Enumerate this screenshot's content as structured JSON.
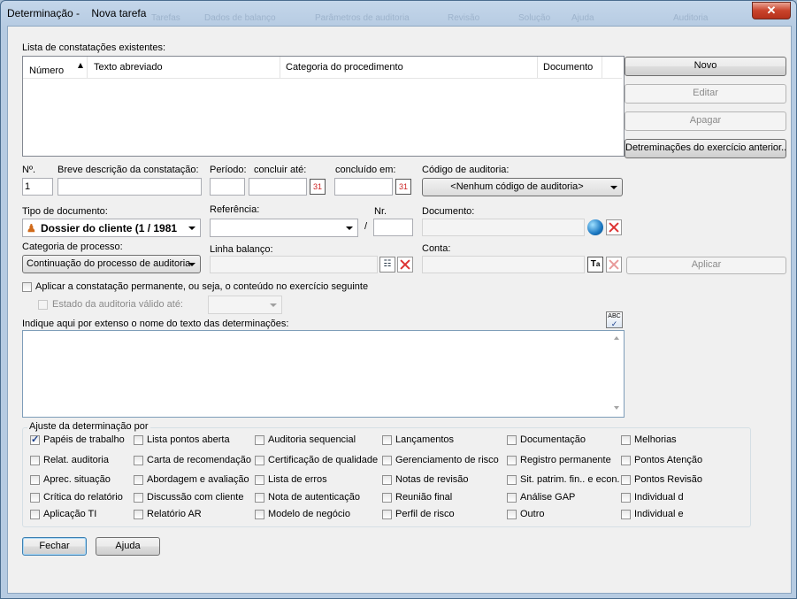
{
  "window": {
    "title": "Determinação -    Nova tarefa",
    "close_label": "✕",
    "background_menu": [
      "Tarefas",
      "Dados de balanço",
      "Parâmetros de auditoria",
      "Revisão",
      "Solução",
      "Ajuda",
      "Auditoria"
    ]
  },
  "findings_list": {
    "label": "Lista de constatações existentes:",
    "columns": [
      "Número",
      "Texto abreviado",
      "Categoria do procedimento",
      "Documento"
    ],
    "rows": []
  },
  "side_buttons": {
    "new": "Novo",
    "edit": "Editar",
    "delete": "Apagar",
    "prev_year": "Detreminações do exercício anterior..."
  },
  "fields": {
    "number_label": "Nº.",
    "number_value": "1",
    "short_desc_label": "Breve descrição da constatação:",
    "short_desc_value": "",
    "period_label": "Período:",
    "conclude_by_label": "concluir até:",
    "concluded_on_label": "concluído em:",
    "audit_code_label": "Código de auditoria:",
    "audit_code_value": "<Nenhum código de auditoria>",
    "doc_type_label": "Tipo de documento:",
    "doc_type_value": "Dossier do cliente (1 / 1981",
    "reference_label": "Referência:",
    "nr_label": "Nr.",
    "slash": "/",
    "document_label": "Documento:",
    "process_cat_label": "Categoria de processo:",
    "process_cat_value": "Continuação do processo de auditoria",
    "balance_line_label": "Linha balanço:",
    "account_label": "Conta:",
    "apply_button": "Aplicar",
    "permanent_check_label": "Aplicar a constatação permanente, ou seja, o conteúdo no exercício seguinte",
    "audit_state_label": "Estado da auditoria válido até:",
    "determination_text_label": "Indique aqui por extenso o nome do texto das determinações:",
    "calendar_icon_text": "31",
    "spell_icon_text": "ABC"
  },
  "adjust_group": {
    "label": "Ajuste da determinação por",
    "columns": [
      [
        {
          "label": "Papéis de trabalho",
          "checked": true
        },
        {
          "label": "Relat. auditoria",
          "checked": false
        },
        {
          "label": "Aprec. situação",
          "checked": false
        },
        {
          "label": "Crítica do relatório",
          "checked": false
        },
        {
          "label": "Aplicação TI",
          "checked": false
        }
      ],
      [
        {
          "label": "Lista pontos aberta",
          "checked": false
        },
        {
          "label": "Carta de recomendação",
          "checked": false
        },
        {
          "label": "Abordagem e avaliação",
          "checked": false
        },
        {
          "label": "Discussão com cliente",
          "checked": false
        },
        {
          "label": "Relatório AR",
          "checked": false
        }
      ],
      [
        {
          "label": "Auditoria sequencial",
          "checked": false
        },
        {
          "label": "Certificação de qualidade",
          "checked": false
        },
        {
          "label": "Lista de erros",
          "checked": false
        },
        {
          "label": "Nota de autenticação",
          "checked": false
        },
        {
          "label": "Modelo de negócio",
          "checked": false
        }
      ],
      [
        {
          "label": "Lançamentos",
          "checked": false
        },
        {
          "label": "Gerenciamento de risco",
          "checked": false
        },
        {
          "label": "Notas de revisão",
          "checked": false
        },
        {
          "label": "Reunião final",
          "checked": false
        },
        {
          "label": "Perfil de risco",
          "checked": false
        }
      ],
      [
        {
          "label": "Documentação",
          "checked": false
        },
        {
          "label": "Registro permanente",
          "checked": false
        },
        {
          "label": "Sit. patrim. fin.. e econ.",
          "checked": false
        },
        {
          "label": "Análise GAP",
          "checked": false
        },
        {
          "label": "Outro",
          "checked": false
        }
      ],
      [
        {
          "label": "Melhorias",
          "checked": false
        },
        {
          "label": "Pontos Atenção",
          "checked": false
        },
        {
          "label": "Pontos Revisão",
          "checked": false
        },
        {
          "label": "Individual d",
          "checked": false
        },
        {
          "label": "Individual e",
          "checked": false
        }
      ]
    ]
  },
  "footer": {
    "close": "Fechar",
    "help": "Ajuda"
  }
}
